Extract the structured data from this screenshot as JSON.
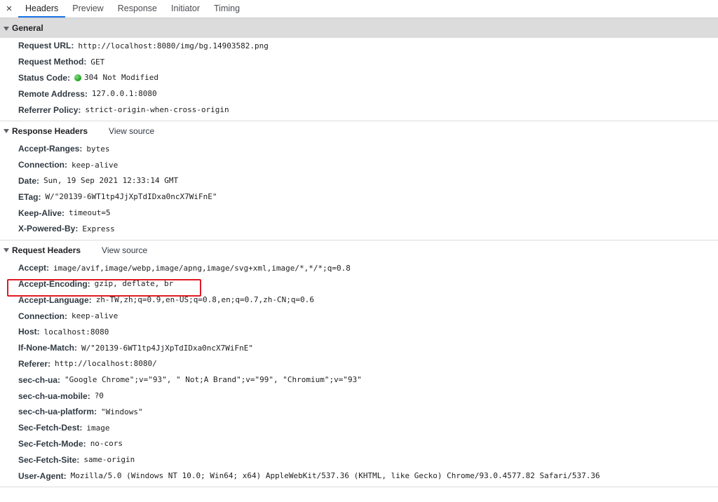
{
  "tabs": {
    "close": "×",
    "items": [
      "Headers",
      "Preview",
      "Response",
      "Initiator",
      "Timing"
    ]
  },
  "general": {
    "title": "General",
    "rows": [
      {
        "key": "Request URL:",
        "value": "http://localhost:8080/img/bg.14903582.png"
      },
      {
        "key": "Request Method:",
        "value": "GET"
      },
      {
        "key": "Status Code:",
        "value": "304 Not Modified"
      },
      {
        "key": "Remote Address:",
        "value": "127.0.0.1:8080"
      },
      {
        "key": "Referrer Policy:",
        "value": "strict-origin-when-cross-origin"
      }
    ]
  },
  "response_headers": {
    "title": "Response Headers",
    "view_source": "View source",
    "rows": [
      {
        "key": "Accept-Ranges:",
        "value": "bytes"
      },
      {
        "key": "Connection:",
        "value": "keep-alive"
      },
      {
        "key": "Date:",
        "value": "Sun, 19 Sep 2021 12:33:14 GMT"
      },
      {
        "key": "ETag:",
        "value": "W/\"20139-6WT1tp4JjXpTdIDxa0ncX7WiFnE\""
      },
      {
        "key": "Keep-Alive:",
        "value": "timeout=5"
      },
      {
        "key": "X-Powered-By:",
        "value": "Express"
      }
    ]
  },
  "request_headers": {
    "title": "Request Headers",
    "view_source": "View source",
    "rows": [
      {
        "key": "Accept:",
        "value": "image/avif,image/webp,image/apng,image/svg+xml,image/*,*/*;q=0.8"
      },
      {
        "key": "Accept-Encoding:",
        "value": "gzip, deflate, br"
      },
      {
        "key": "Accept-Language:",
        "value": "zh-TW,zh;q=0.9,en-US;q=0.8,en;q=0.7,zh-CN;q=0.6"
      },
      {
        "key": "Connection:",
        "value": "keep-alive"
      },
      {
        "key": "Host:",
        "value": "localhost:8080"
      },
      {
        "key": "If-None-Match:",
        "value": "W/\"20139-6WT1tp4JjXpTdIDxa0ncX7WiFnE\""
      },
      {
        "key": "Referer:",
        "value": "http://localhost:8080/"
      },
      {
        "key": "sec-ch-ua:",
        "value": "\"Google Chrome\";v=\"93\", \" Not;A Brand\";v=\"99\", \"Chromium\";v=\"93\""
      },
      {
        "key": "sec-ch-ua-mobile:",
        "value": "?0"
      },
      {
        "key": "sec-ch-ua-platform:",
        "value": "\"Windows\""
      },
      {
        "key": "Sec-Fetch-Dest:",
        "value": "image"
      },
      {
        "key": "Sec-Fetch-Mode:",
        "value": "no-cors"
      },
      {
        "key": "Sec-Fetch-Site:",
        "value": "same-origin"
      },
      {
        "key": "User-Agent:",
        "value": "Mozilla/5.0 (Windows NT 10.0; Win64; x64) AppleWebKit/537.36 (KHTML, like Gecko) Chrome/93.0.4577.82 Safari/537.36"
      }
    ]
  },
  "colors": {
    "active_tab_underline": "#1a73e8",
    "status_ok": "#1e9e1e",
    "highlight": "#e01b24"
  }
}
